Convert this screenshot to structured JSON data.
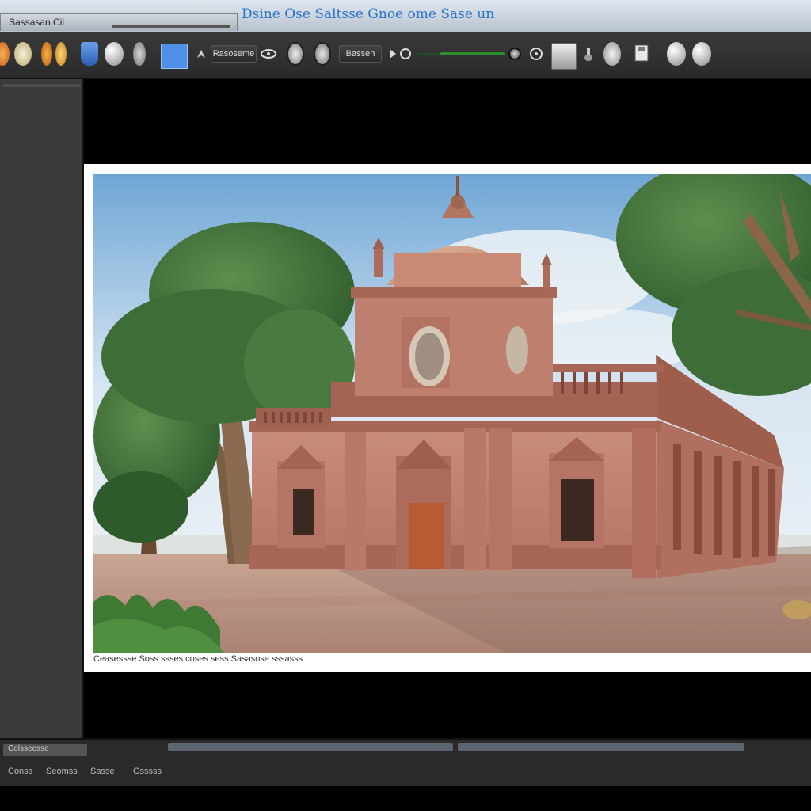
{
  "window": {
    "tab_label": "Sassasan Cil",
    "title": "Dsine Ose Saltsse Gnoe ome Sase un"
  },
  "toolbar": {
    "tools": [
      {
        "name": "orange-swatch-icon",
        "label": ""
      },
      {
        "name": "light-bulb-icon",
        "label": ""
      },
      {
        "name": "color-picker-icon",
        "label": ""
      },
      {
        "name": "shield-icon",
        "label": ""
      },
      {
        "name": "sphere-icon",
        "label": ""
      },
      {
        "name": "material-icon",
        "label": ""
      },
      {
        "name": "blue-frame-icon",
        "label": ""
      },
      {
        "name": "arrow-tool-icon",
        "label": ""
      },
      {
        "name": "render-settings-field",
        "label": "Rasoseme"
      },
      {
        "name": "eye-icon",
        "label": ""
      },
      {
        "name": "globe-icon",
        "label": ""
      },
      {
        "name": "camera-icon",
        "label": ""
      },
      {
        "name": "preset-field",
        "label": "Bassen"
      },
      {
        "name": "play-icon",
        "label": ""
      },
      {
        "name": "quality-slider",
        "label": ""
      },
      {
        "name": "record-icon",
        "label": ""
      },
      {
        "name": "target-icon",
        "label": ""
      },
      {
        "name": "monitor-icon",
        "label": ""
      },
      {
        "name": "brush-icon",
        "label": ""
      },
      {
        "name": "bucket-icon",
        "label": ""
      },
      {
        "name": "save-icon",
        "label": ""
      },
      {
        "name": "settings-icon",
        "label": ""
      },
      {
        "name": "help-icon",
        "label": ""
      }
    ],
    "slider_color": "#2f8f2f"
  },
  "render": {
    "caption": "Ceasessse Soss ssses coses sess Sasasose sssasss"
  },
  "statusbar": {
    "tab_label": "Colsseesse",
    "items": [
      "Conss",
      "Seomss",
      "Sasse",
      "Gsssss"
    ]
  },
  "colors": {
    "accent": "#2a73c8",
    "panel": "#3b3b3b",
    "toolbar": "#2e2e2e"
  }
}
